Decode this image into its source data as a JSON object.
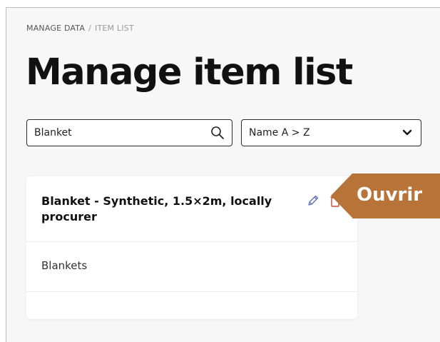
{
  "breadcrumb": {
    "section": "MANAGE DATA",
    "separator": "/",
    "current": "ITEM LIST"
  },
  "page": {
    "title": "Manage item list"
  },
  "search": {
    "value": "Blanket",
    "icon": "search-icon"
  },
  "sort": {
    "selected": "Name A > Z",
    "icon": "chevron-down-icon"
  },
  "items": [
    {
      "title": "Blanket - Synthetic, 1.5×2m, locally procurer",
      "category": "Blankets",
      "actions": {
        "edit_icon": "pencil-icon",
        "delete_icon": "trash-icon"
      }
    }
  ],
  "tooltip": {
    "label": "Ouvrir"
  },
  "colors": {
    "tooltip_background": "#b87438",
    "tooltip_text": "#ffffff",
    "delete_accent": "#c94a3e",
    "edit_accent": "#5b6fb8"
  }
}
